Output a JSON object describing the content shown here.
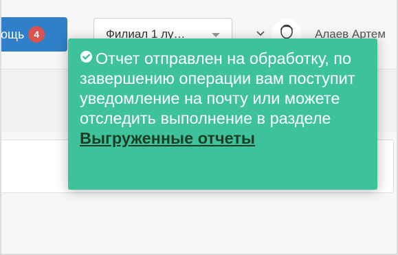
{
  "header": {
    "help_label": "ощь",
    "help_badge": "4",
    "branch_select_value": "Филиал 1 лу…",
    "user_name": "Алаев Артем"
  },
  "toast": {
    "message": "Отчет отправлен на обработку, по завершению операции вам поступит уведомление на почту или можете отследить выполнение в разделе ",
    "link_text": "Выгруженные отчеты"
  },
  "colors": {
    "toast_bg": "#3ec29c",
    "help_button": "#2f80c8",
    "badge": "#d9534f",
    "link": "#1c3c23"
  },
  "icons": {
    "toast": "check-circle-icon",
    "select_caret": "caret-down-icon",
    "user_menu": "chevron-down-icon",
    "avatar": "user-avatar-icon"
  }
}
